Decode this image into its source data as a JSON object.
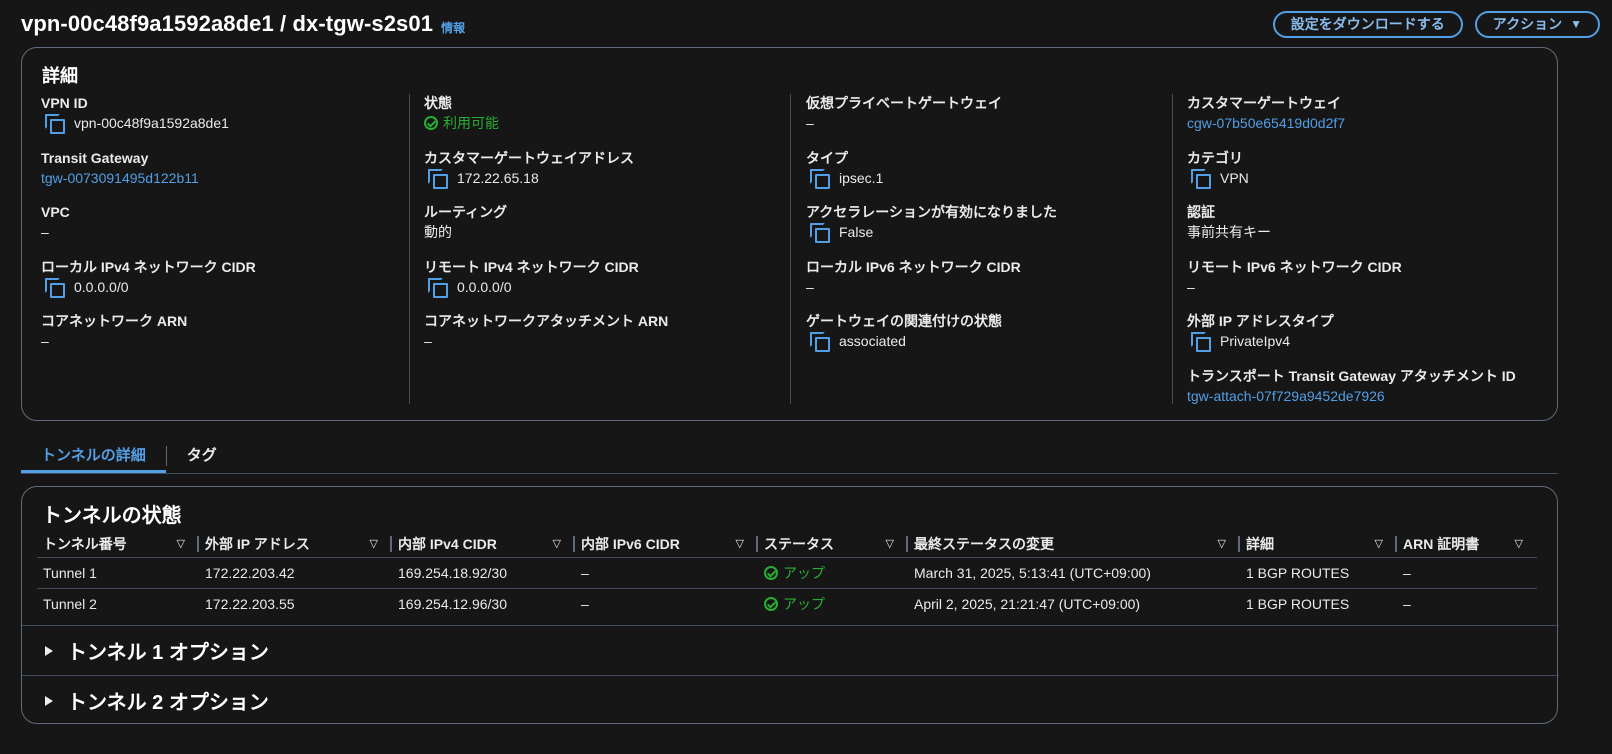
{
  "header": {
    "title": "vpn-00c48f9a1592a8de1 / dx-tgw-s2s01",
    "info_link": "情報",
    "download_button": "設定をダウンロードする",
    "actions_button": "アクション"
  },
  "details": {
    "title": "詳細",
    "col1": [
      {
        "label": "VPN ID",
        "value": "vpn-00c48f9a1592a8de1"
      },
      {
        "label": "Transit Gateway",
        "value": "tgw-0073091495d122b11"
      },
      {
        "label": "VPC",
        "value": "–"
      },
      {
        "label": "ローカル IPv4 ネットワーク CIDR",
        "value": "0.0.0.0/0"
      },
      {
        "label": "コアネットワーク ARN",
        "value": "–"
      }
    ],
    "col2": [
      {
        "label": "状態",
        "value": "利用可能"
      },
      {
        "label": "カスタマーゲートウェイアドレス",
        "value": "172.22.65.18"
      },
      {
        "label": "ルーティング",
        "value": "動的"
      },
      {
        "label": "リモート IPv4 ネットワーク CIDR",
        "value": "0.0.0.0/0"
      },
      {
        "label": "コアネットワークアタッチメント ARN",
        "value": "–"
      }
    ],
    "col3": [
      {
        "label": "仮想プライベートゲートウェイ",
        "value": "–"
      },
      {
        "label": "タイプ",
        "value": "ipsec.1"
      },
      {
        "label": "アクセラレーションが有効になりました",
        "value": "False"
      },
      {
        "label": "ローカル IPv6 ネットワーク CIDR",
        "value": "–"
      },
      {
        "label": "ゲートウェイの関連付けの状態",
        "value": "associated"
      }
    ],
    "col4": [
      {
        "label": "カスタマーゲートウェイ",
        "value": "cgw-07b50e65419d0d2f7"
      },
      {
        "label": "カテゴリ",
        "value": "VPN"
      },
      {
        "label": "認証",
        "value": "事前共有キー"
      },
      {
        "label": "リモート IPv6 ネットワーク CIDR",
        "value": "–"
      },
      {
        "label": "外部 IP アドレスタイプ",
        "value": "PrivateIpv4"
      },
      {
        "label": "トランスポート Transit Gateway アタッチメント ID",
        "value": "tgw-attach-07f729a9452de7926"
      }
    ]
  },
  "tabs": [
    {
      "label": "トンネルの詳細",
      "active": true
    },
    {
      "label": "タグ",
      "active": false
    }
  ],
  "tunnel_state": {
    "title": "トンネルの状態",
    "columns": [
      "トンネル番号",
      "外部 IP アドレス",
      "内部 IPv4 CIDR",
      "内部 IPv6 CIDR",
      "ステータス",
      "最終ステータスの変更",
      "詳細",
      "ARN 証明書"
    ],
    "rows": [
      [
        "Tunnel 1",
        "172.22.203.42",
        "169.254.18.92/30",
        "–",
        "アップ",
        "March 31, 2025, 5:13:41 (UTC+09:00)",
        "1 BGP ROUTES",
        "–"
      ],
      [
        "Tunnel 2",
        "172.22.203.55",
        "169.254.12.96/30",
        "–",
        "アップ",
        "April 2, 2025, 21:21:47 (UTC+09:00)",
        "1 BGP ROUTES",
        "–"
      ]
    ]
  },
  "expanders": {
    "tunnel1": "トンネル 1 オプション",
    "tunnel2": "トンネル 2 オプション"
  },
  "colors": {
    "background": "#161616",
    "link": "#539fe5",
    "success": "#29ad32",
    "border": "#5f6b7a"
  },
  "icons": {
    "copy": "copy-icon",
    "status_ok": "check-circle-icon",
    "sort": "caret-down-icon",
    "expand": "caret-right-icon"
  }
}
